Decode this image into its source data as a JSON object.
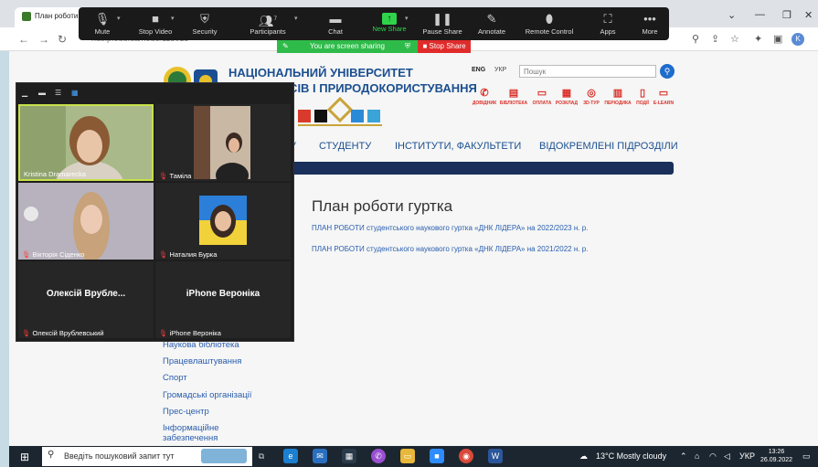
{
  "browser": {
    "tab_title": "План роботи",
    "url": "nubip.edu.ua/node/113013",
    "profile_letter": "K",
    "window_controls": [
      "⌄",
      "—",
      "❐",
      "✕"
    ]
  },
  "zoom_toolbar": {
    "buttons": [
      {
        "label": "Mute",
        "icon": "mic-icon"
      },
      {
        "label": "Stop Video",
        "icon": "video-icon"
      },
      {
        "label": "Security",
        "icon": "shield-icon"
      },
      {
        "label": "Participants",
        "icon": "participants-icon",
        "count": "7"
      },
      {
        "label": "Chat",
        "icon": "chat-icon"
      },
      {
        "label": "New Share",
        "icon": "share-icon"
      },
      {
        "label": "Pause Share",
        "icon": "pause-icon"
      },
      {
        "label": "Annotate",
        "icon": "pen-icon"
      },
      {
        "label": "Remote Control",
        "icon": "mouse-icon"
      },
      {
        "label": "Apps",
        "icon": "apps-icon"
      },
      {
        "label": "More",
        "icon": "more-icon"
      }
    ],
    "sharing_banner": "You are screen sharing",
    "stop_share": "Stop Share",
    "share_color": "#2fd44b"
  },
  "website": {
    "university_name_line1": "НАЦІОНАЛЬНИЙ УНІВЕРСИТЕТ",
    "university_name_line2": "БІОРЕСУРСІВ І ПРИРОДОКОРИСТУВАННЯ",
    "lang_en": "ENG",
    "lang_uk": "УКР",
    "search_placeholder": "Пошук",
    "quick_links": [
      "ДОВІДНИК",
      "БІБЛІОТЕКА",
      "ОПЛАТА",
      "РОЗКЛАД",
      "3D-ТУР",
      "ПЕРІОДИКА",
      "ПОДІЇ",
      "E-LEARN"
    ],
    "menu": [
      "У",
      "СТУДЕНТУ",
      "ІНСТИТУТИ, ФАКУЛЬТЕТИ",
      "ВІДОКРЕМЛЕНІ ПІДРОЗДІЛИ"
    ],
    "page_title": "План роботи гуртка",
    "documents": [
      "ПЛАН РОБОТИ студентського наукового гуртка «ДНК ЛІДЕРА» на 2022/2023 н. р.",
      "ПЛАН РОБОТИ студентського наукового гуртка «ДНК ЛІДЕРА» на 2021/2022 н. р."
    ],
    "sidebar_links": [
      "Наукова бібліотека",
      "Працевлаштування",
      "Спорт",
      "Громадські організації",
      "Прес-центр",
      "Інформаційне забезпечення"
    ],
    "brand_color": "#1c4f91"
  },
  "participants": [
    {
      "name": "Kristina Dramarecka",
      "muted": false,
      "video": true,
      "active": true
    },
    {
      "name": "Таміла",
      "muted": true,
      "video": true,
      "active": false
    },
    {
      "name": "Вікторія Сіденко",
      "muted": true,
      "video": true,
      "active": false
    },
    {
      "name": "Наталия Бурка",
      "muted": true,
      "video": true,
      "active": false
    },
    {
      "name": "Олексій Врублевський",
      "display": "Олексій Врубле...",
      "muted": true,
      "video": false,
      "active": false
    },
    {
      "name": "iPhone Вероніка",
      "display": "iPhone Вероніка",
      "muted": true,
      "video": false,
      "active": false
    }
  ],
  "taskbar": {
    "search_placeholder": "Введіть пошуковий запит тут",
    "weather": "13°C  Mostly cloudy",
    "language": "УКР",
    "time": "13:26",
    "date": "26.09.2022"
  }
}
